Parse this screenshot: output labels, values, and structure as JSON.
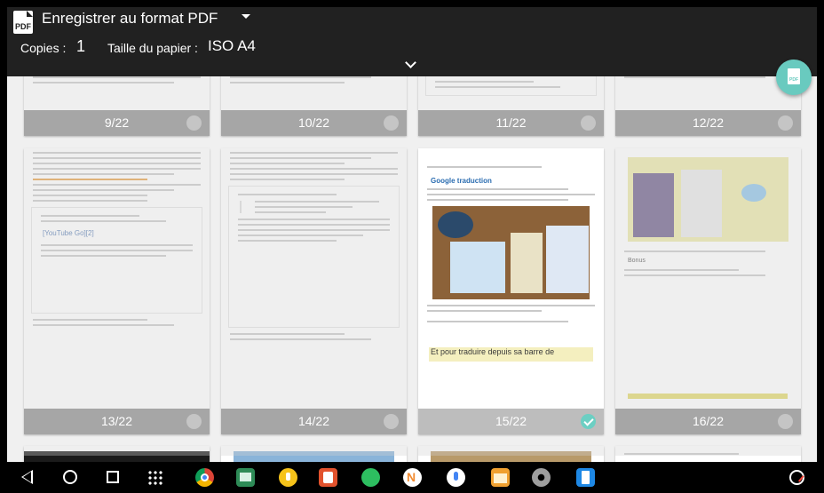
{
  "header": {
    "printer_name": "Enregistrer au format PDF",
    "copies_label": "Copies :",
    "copies_value": "1",
    "paper_label": "Taille du papier :",
    "paper_value": "ISO A4"
  },
  "fab": {
    "label": "PDF"
  },
  "pages": [
    {
      "label": "9/22"
    },
    {
      "label": "10/22"
    },
    {
      "label": "11/22"
    },
    {
      "label": "12/22"
    },
    {
      "label": "13/22"
    },
    {
      "label": "14/22"
    },
    {
      "label": "15/22",
      "selected": true
    },
    {
      "label": "16/22"
    }
  ],
  "page_snippets": {
    "p13_link": "[YouTube Go][2]",
    "p15_title": "Google traduction",
    "p16_heading": "Bonus",
    "p15_bottom": "Et pour traduire depuis sa barre de"
  },
  "colors": {
    "header_bg": "#212121",
    "accent": "#69cabf",
    "footer_gray": "#969696"
  },
  "navbar": {
    "icons": [
      "back-icon",
      "home-icon",
      "recents-icon",
      "apps-icon",
      "chrome-icon",
      "slides-icon",
      "keep-icon",
      "translate-ppt-icon",
      "evernote-icon",
      "notes-icon",
      "mic-icon",
      "files-icon",
      "settings-icon",
      "phone-app-icon",
      "status-icon"
    ]
  }
}
